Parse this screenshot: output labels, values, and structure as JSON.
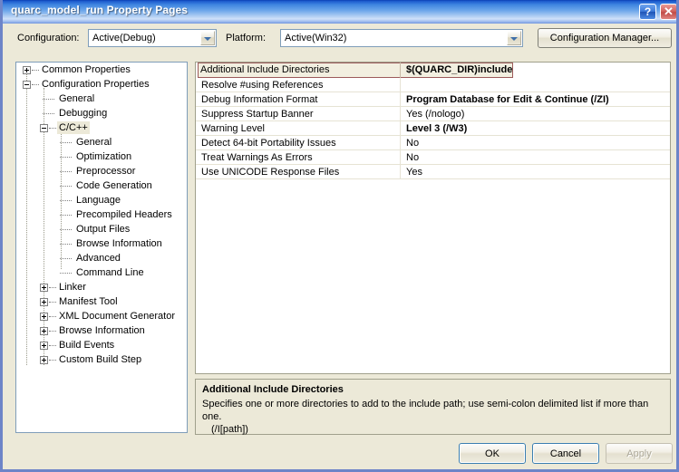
{
  "window": {
    "title": "quarc_model_run Property Pages",
    "help_button": "?",
    "close_button": "✕"
  },
  "configbar": {
    "configuration_label": "Configuration:",
    "configuration_value": "Active(Debug)",
    "platform_label": "Platform:",
    "platform_value": "Active(Win32)",
    "config_manager_button": "Configuration Manager..."
  },
  "tree": {
    "nodes": [
      {
        "label": "Common Properties",
        "depth": 0,
        "toggle": "plus",
        "selected": false
      },
      {
        "label": "Configuration Properties",
        "depth": 0,
        "toggle": "minus",
        "selected": false
      },
      {
        "label": "General",
        "depth": 1,
        "toggle": "none",
        "selected": false
      },
      {
        "label": "Debugging",
        "depth": 1,
        "toggle": "none",
        "selected": false
      },
      {
        "label": "C/C++",
        "depth": 1,
        "toggle": "minus",
        "selected": true
      },
      {
        "label": "General",
        "depth": 2,
        "toggle": "none",
        "selected": false
      },
      {
        "label": "Optimization",
        "depth": 2,
        "toggle": "none",
        "selected": false
      },
      {
        "label": "Preprocessor",
        "depth": 2,
        "toggle": "none",
        "selected": false
      },
      {
        "label": "Code Generation",
        "depth": 2,
        "toggle": "none",
        "selected": false
      },
      {
        "label": "Language",
        "depth": 2,
        "toggle": "none",
        "selected": false
      },
      {
        "label": "Precompiled Headers",
        "depth": 2,
        "toggle": "none",
        "selected": false
      },
      {
        "label": "Output Files",
        "depth": 2,
        "toggle": "none",
        "selected": false
      },
      {
        "label": "Browse Information",
        "depth": 2,
        "toggle": "none",
        "selected": false
      },
      {
        "label": "Advanced",
        "depth": 2,
        "toggle": "none",
        "selected": false
      },
      {
        "label": "Command Line",
        "depth": 2,
        "toggle": "none",
        "selected": false
      },
      {
        "label": "Linker",
        "depth": 1,
        "toggle": "plus",
        "selected": false
      },
      {
        "label": "Manifest Tool",
        "depth": 1,
        "toggle": "plus",
        "selected": false
      },
      {
        "label": "XML Document Generator",
        "depth": 1,
        "toggle": "plus",
        "selected": false
      },
      {
        "label": "Browse Information",
        "depth": 1,
        "toggle": "plus",
        "selected": false
      },
      {
        "label": "Build Events",
        "depth": 1,
        "toggle": "plus",
        "selected": false
      },
      {
        "label": "Custom Build Step",
        "depth": 1,
        "toggle": "plus",
        "selected": false
      }
    ]
  },
  "grid": {
    "rows": [
      {
        "name": "Additional Include Directories",
        "value": "$(QUARC_DIR)include",
        "bold": true,
        "selected": true
      },
      {
        "name": "Resolve #using References",
        "value": "",
        "bold": false,
        "selected": false
      },
      {
        "name": "Debug Information Format",
        "value": "Program Database for Edit & Continue (/ZI)",
        "bold": true,
        "selected": false
      },
      {
        "name": "Suppress Startup Banner",
        "value": "Yes (/nologo)",
        "bold": false,
        "selected": false
      },
      {
        "name": "Warning Level",
        "value": "Level 3 (/W3)",
        "bold": true,
        "selected": false
      },
      {
        "name": "Detect 64-bit Portability Issues",
        "value": "No",
        "bold": false,
        "selected": false
      },
      {
        "name": "Treat Warnings As Errors",
        "value": "No",
        "bold": false,
        "selected": false
      },
      {
        "name": "Use UNICODE Response Files",
        "value": "Yes",
        "bold": false,
        "selected": false
      }
    ]
  },
  "description": {
    "title": "Additional Include Directories",
    "text": "Specifies one or more directories to add to the include path; use semi-colon delimited list if more than one.",
    "continuation": "(/I[path])"
  },
  "buttons": {
    "ok": "OK",
    "cancel": "Cancel",
    "apply": "Apply"
  },
  "colors": {
    "title_bar_blue": "#1f5fd0",
    "dialog_face": "#ece9d8",
    "selected_row_border": "#9c5a5a",
    "tree_selection": "#ece9d8",
    "field_border": "#7f9db9"
  }
}
